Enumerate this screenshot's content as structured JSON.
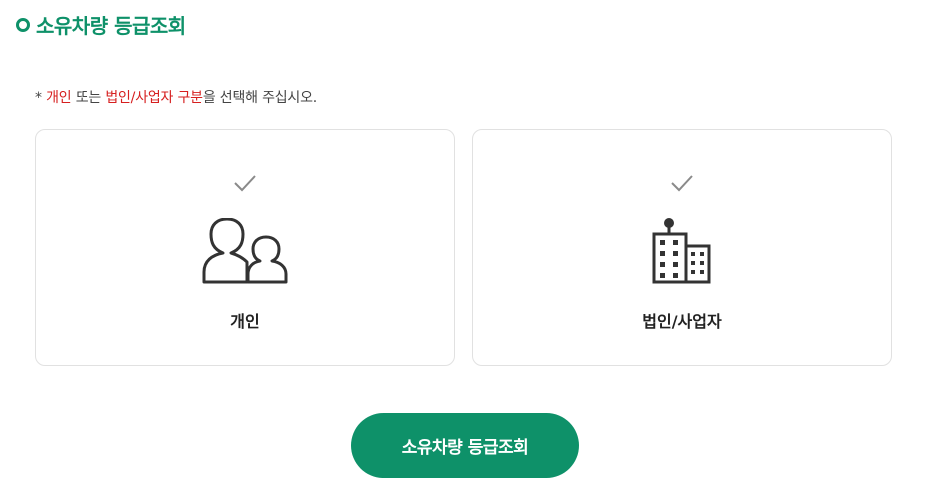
{
  "header": {
    "title": "소유차량 등급조회",
    "accent_color": "#0e9169"
  },
  "notice": {
    "prefix": "* ",
    "part1": "개인",
    "part2": " 또는 ",
    "part3": "법인/사업자 구분",
    "part4": "을 선택해 주십시오.",
    "highlight_color": "#d61f1f"
  },
  "options": [
    {
      "label": "개인",
      "icon": "people-icon",
      "selected": false
    },
    {
      "label": "법인/사업자",
      "icon": "building-icon",
      "selected": false
    }
  ],
  "submit": {
    "label": "소유차량 등급조회"
  }
}
